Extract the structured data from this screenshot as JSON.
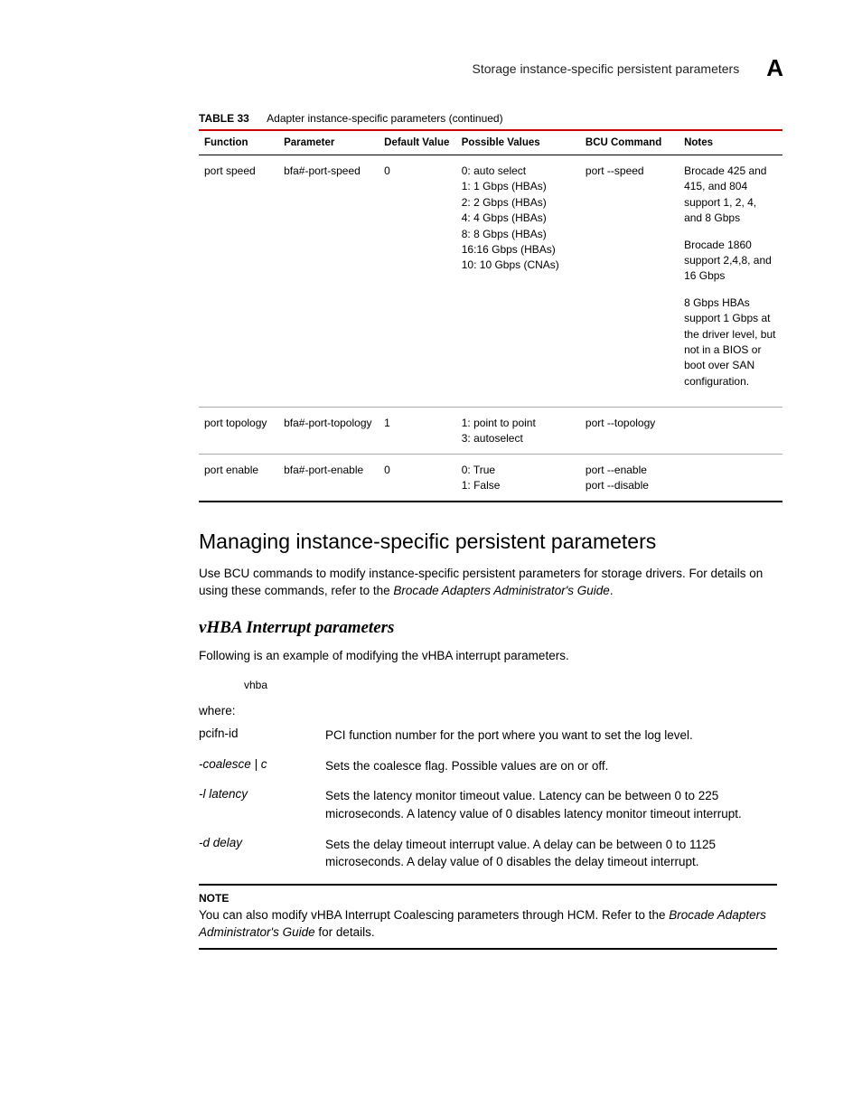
{
  "header": {
    "running_title": "Storage instance-specific persistent parameters",
    "section_letter": "A"
  },
  "table": {
    "label": "TABLE 33",
    "caption": "Adapter instance-specific parameters  (continued)",
    "columns": [
      "Function",
      "Parameter",
      "Default Value",
      "Possible Values",
      "BCU Command",
      "Notes"
    ],
    "rows": [
      {
        "function": "port speed",
        "parameter": "bfa#-port-speed",
        "default": "0",
        "possible": "0: auto select\n1: 1 Gbps (HBAs)\n2: 2 Gbps (HBAs)\n4: 4 Gbps (HBAs)\n8: 8 Gbps (HBAs)\n16:16 Gbps (HBAs)\n10: 10 Gbps (CNAs)",
        "bcu": "port --speed",
        "notes": "Brocade 425 and 415, and 804 support 1, 2, 4, and 8 Gbps\n\nBrocade 1860 support 2,4,8, and 16 Gbps\n\n8 Gbps HBAs support 1 Gbps at the driver level, but not in a BIOS or boot over SAN configuration."
      },
      {
        "function": "port topology",
        "parameter": "bfa#-port-topology",
        "default": "1",
        "possible": "1: point to point\n3: autoselect",
        "bcu": "port --topology",
        "notes": ""
      },
      {
        "function": "port enable",
        "parameter": "bfa#-port-enable",
        "default": "0",
        "possible": "0: True\n1: False",
        "bcu": "port --enable\nport --disable",
        "notes": ""
      }
    ]
  },
  "h2": "Managing instance-specific persistent parameters",
  "para1_a": "Use BCU commands to modify instance-specific persistent parameters for storage drivers. For details on using these commands, refer to the ",
  "para1_em": "Brocade Adapters Administrator's Guide",
  "para1_b": ".",
  "h3": "vHBA Interrupt parameters",
  "para2": "Following is an example of modifying the vHBA interrupt parameters.",
  "code": "vhba",
  "where": "where:",
  "defs": [
    {
      "term": "pcifn-id",
      "italic": false,
      "desc": "PCI function number for the port where you want to set the log level."
    },
    {
      "term": "-coalesce | c",
      "italic": true,
      "desc": "Sets the coalesce flag. Possible values are on or off."
    },
    {
      "term": "-l latency",
      "italic": true,
      "desc": "Sets the latency monitor timeout value. Latency can be between 0 to 225 microseconds. A latency value of 0 disables latency monitor timeout interrupt."
    },
    {
      "term": "-d delay",
      "italic": true,
      "desc": "Sets the delay timeout interrupt value. A delay can be between 0 to 1125 microseconds. A delay value of 0 disables the delay timeout interrupt."
    }
  ],
  "note": {
    "label": "NOTE",
    "body_a": "You can also modify vHBA Interrupt Coalescing parameters through HCM. Refer to the ",
    "body_em": "Brocade Adapters Administrator's Guide",
    "body_b": " for details."
  }
}
